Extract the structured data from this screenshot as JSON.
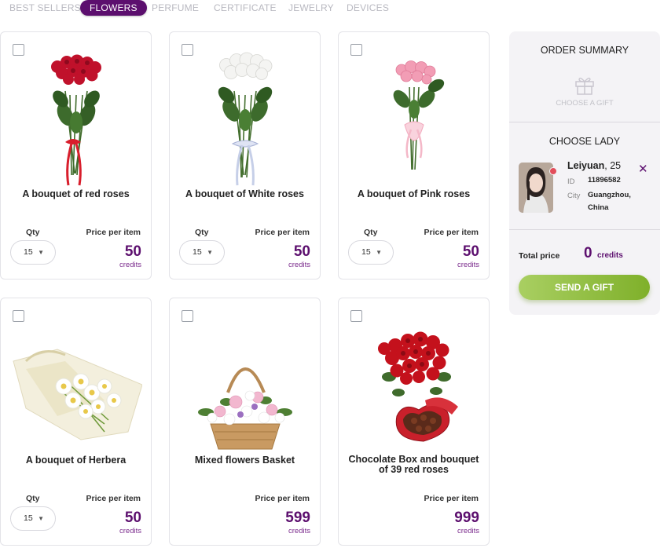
{
  "tabs": [
    {
      "label": "BEST SELLERS",
      "active": false
    },
    {
      "label": "FLOWERS",
      "active": true
    },
    {
      "label": "PERFUME",
      "active": false
    },
    {
      "label": "CERTIFICATE",
      "active": false
    },
    {
      "label": "JEWELRY",
      "active": false
    },
    {
      "label": "DEVICES",
      "active": false
    }
  ],
  "common": {
    "qty_label": "Qty",
    "price_label": "Price per item",
    "credits_label": "credits"
  },
  "products": [
    {
      "name": "A bouquet of red roses",
      "qty": "15",
      "price": "50",
      "image": "red-roses-bouquet"
    },
    {
      "name": "A bouquet of White roses",
      "qty": "15",
      "price": "50",
      "image": "white-roses-bouquet"
    },
    {
      "name": "A bouquet of Pink roses",
      "qty": "15",
      "price": "50",
      "image": "pink-roses-bouquet"
    },
    {
      "name": "A bouquet of Herbera",
      "qty": "15",
      "price": "50",
      "image": "herbera-bouquet"
    },
    {
      "name": "Mixed flowers Basket",
      "qty": null,
      "price": "599",
      "image": "flower-basket"
    },
    {
      "name": "Chocolate Box and bouquet of 39 red roses",
      "qty": null,
      "price": "999",
      "image": "chocolate-box-roses"
    }
  ],
  "summary": {
    "title": "ORDER SUMMARY",
    "choose_gift": "CHOOSE A GIFT",
    "choose_lady": "CHOOSE LADY",
    "lady": {
      "name": "Leiyuan",
      "age_text": ", 25",
      "id_label": "ID",
      "id": "11896582",
      "city_label": "City",
      "city_line1": "Guangzhou,",
      "city_line2": "China",
      "online": true
    },
    "total_label": "Total price",
    "total_value": "0",
    "total_credits": "credits",
    "send_button": "SEND A GIFT"
  },
  "colors": {
    "accent": "#5c0f6e",
    "tab_inactive": "#b8b8c0",
    "send_button": "#8fbf3a",
    "online_dot": "#e24d5a"
  }
}
